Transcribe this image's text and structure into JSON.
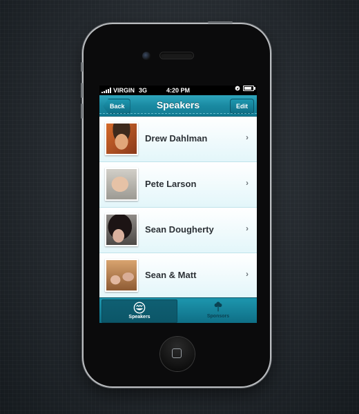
{
  "status_bar": {
    "carrier": "VIRGIN",
    "network": "3G",
    "time": "4:20 PM"
  },
  "nav": {
    "back_label": "Back",
    "title": "Speakers",
    "edit_label": "Edit"
  },
  "speakers": [
    {
      "name": "Drew Dahlman"
    },
    {
      "name": "Pete Larson"
    },
    {
      "name": "Sean Dougherty"
    },
    {
      "name": "Sean & Matt"
    }
  ],
  "tabs": [
    {
      "label": "Speakers",
      "icon": "smiley-icon",
      "active": true
    },
    {
      "label": "Sponsors",
      "icon": "tree-icon",
      "active": false
    }
  ],
  "colors": {
    "accent": "#1a8aa2",
    "row": "#e3f6fa",
    "text": "#2c3136"
  }
}
